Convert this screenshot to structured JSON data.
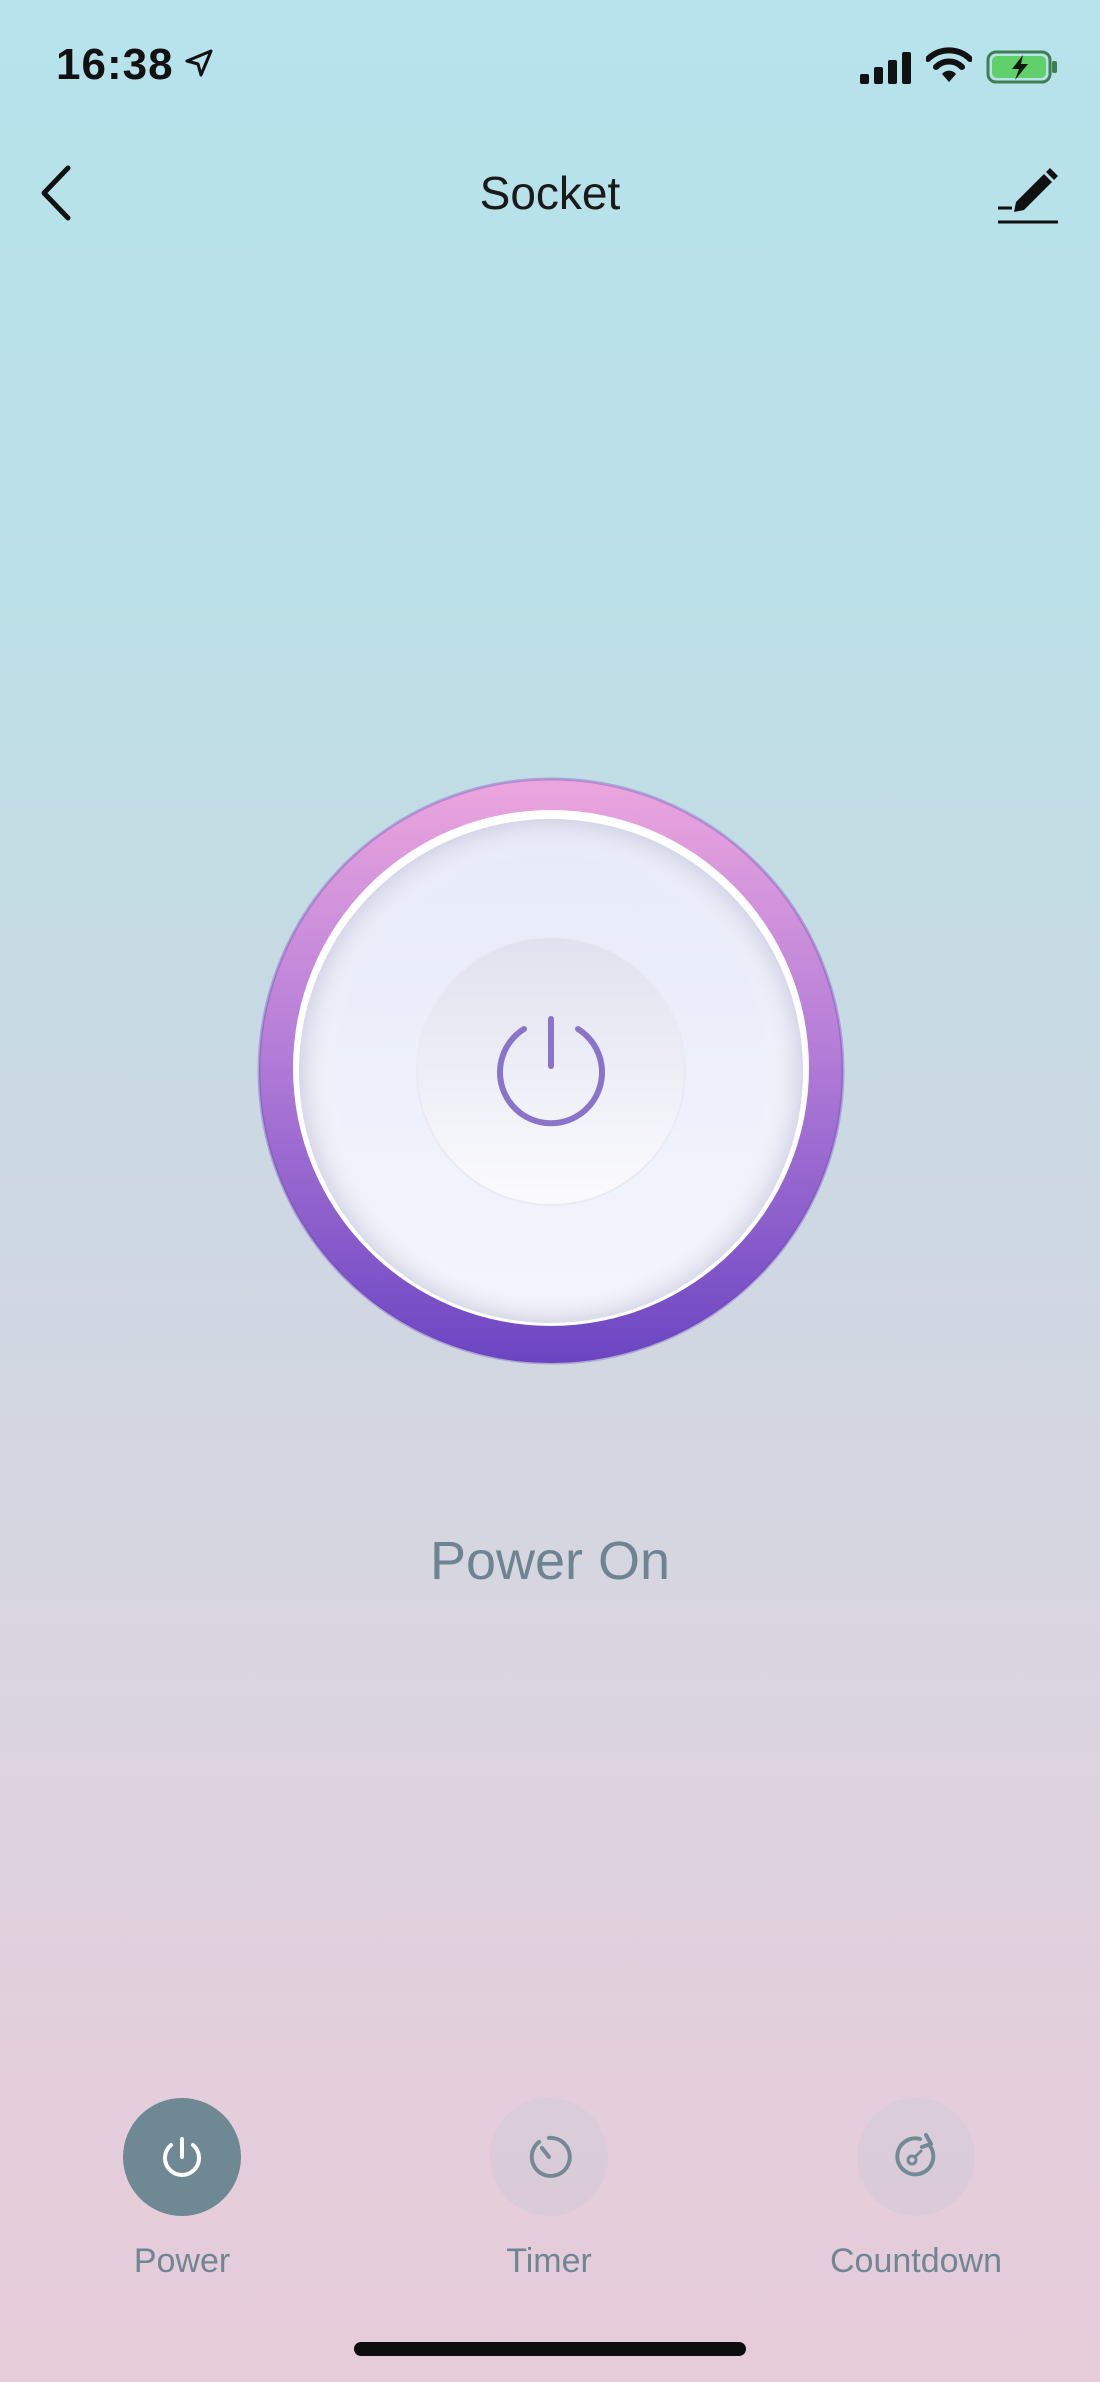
{
  "status_bar": {
    "time": "16:38",
    "icons": [
      "location-arrow-icon",
      "cellular-signal-icon",
      "wifi-icon",
      "battery-charging-icon"
    ]
  },
  "header": {
    "title": "Socket",
    "back_icon": "chevron-left-icon",
    "edit_icon": "pencil-icon"
  },
  "main": {
    "power_button_icon": "power-icon",
    "status_text": "Power On",
    "colors": {
      "ring_top": "#eca6de",
      "ring_bottom": "#6b45c2",
      "power_glyph": "#8a74c9"
    }
  },
  "tabs": [
    {
      "label": "Power",
      "icon": "power-icon",
      "active": true
    },
    {
      "label": "Timer",
      "icon": "timer-icon",
      "active": false
    },
    {
      "label": "Countdown",
      "icon": "countdown-icon",
      "active": false
    }
  ],
  "colors": {
    "background_top": "#b6e3ec",
    "background_bottom": "#e6cbd9",
    "active_tab": "#6f8994",
    "label_text": "#6f8792"
  }
}
